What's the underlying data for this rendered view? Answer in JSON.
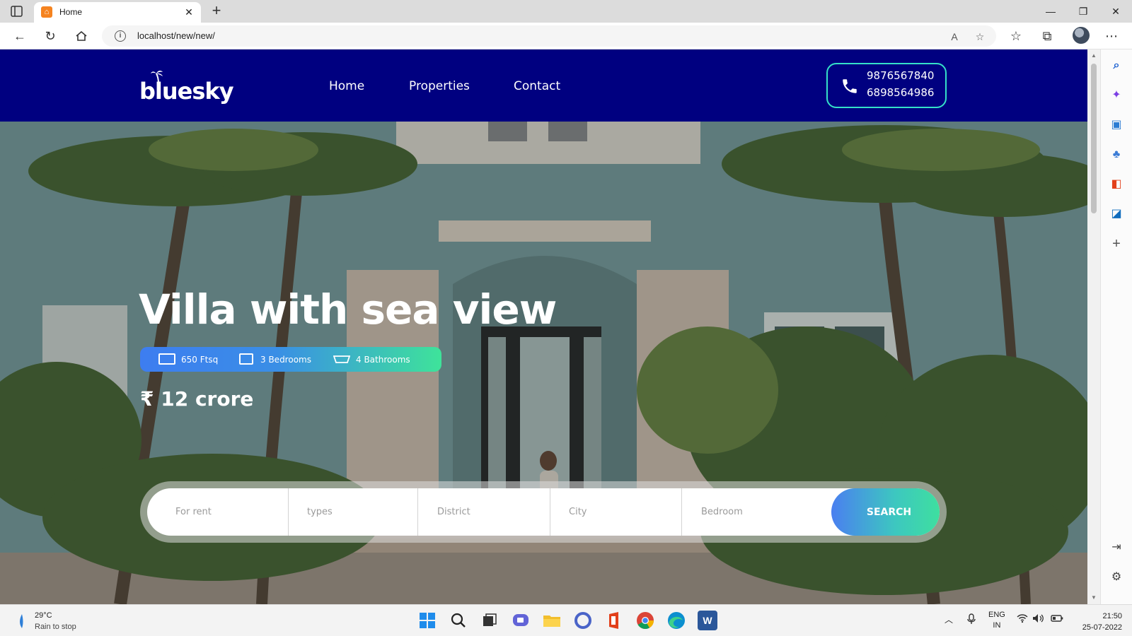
{
  "browser": {
    "tab_title": "Home",
    "tab_favicon": "⌂",
    "url": "localhost/new/new/",
    "icons": [
      "tab-actions-icon",
      "close-icon",
      "plus-icon",
      "minimize-icon",
      "restore-icon",
      "window-close-icon",
      "back-icon",
      "refresh-icon",
      "home-icon",
      "info-icon",
      "read-aloud-icon",
      "add-favorite-icon",
      "favorites-icon",
      "collections-icon",
      "more-icon"
    ]
  },
  "site": {
    "logo": "bluesky",
    "nav": [
      {
        "label": "Home"
      },
      {
        "label": "Properties"
      },
      {
        "label": "Contact"
      }
    ],
    "phones": [
      "9876567840",
      "6898564986"
    ]
  },
  "hero": {
    "title": "Villa with sea view",
    "features": [
      {
        "icon": "area-icon",
        "label": "650 Ftsq"
      },
      {
        "icon": "bed-icon",
        "label": "3 Bedrooms"
      },
      {
        "icon": "bath-icon",
        "label": "4 Bathrooms"
      }
    ],
    "price": "₹ 12 crore"
  },
  "search": {
    "fields": [
      {
        "placeholder": "For rent"
      },
      {
        "placeholder": "types"
      },
      {
        "placeholder": "District"
      },
      {
        "placeholder": "City"
      },
      {
        "placeholder": "Bedroom"
      }
    ],
    "button_label": "SEARCH"
  },
  "taskbar": {
    "weather_temp": "29°C",
    "weather_desc": "Rain to stop",
    "lang_top": "ENG",
    "lang_bottom": "IN",
    "time": "21:50",
    "date": "25-07-2022"
  }
}
